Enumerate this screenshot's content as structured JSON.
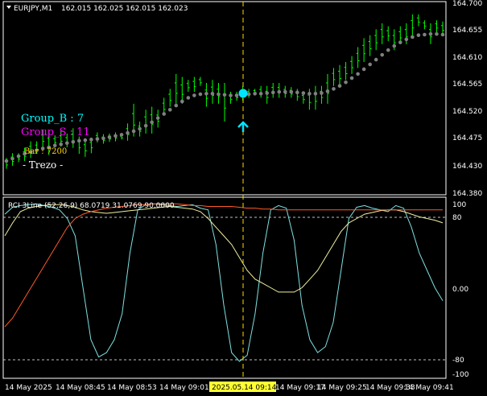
{
  "header": {
    "symbol": "EURJPY,M1",
    "ohlc": "162.015 162.025 162.015 162.023"
  },
  "overlay": {
    "group_b": "Group_B : 7",
    "group_s": "Group_S : 11",
    "bar": "Bar : 7200",
    "trezo": "- Trezo -"
  },
  "price_axis": [
    "164.700",
    "164.655",
    "164.610",
    "164.565",
    "164.520",
    "164.475",
    "164.430",
    "164.380"
  ],
  "indicator": {
    "label": "RCI 3Line (52,26,9) 68.0719 31.0769 90.0000",
    "axis": [
      "100",
      "80",
      "0.00",
      "-80",
      "-100"
    ]
  },
  "time_axis": [
    "14 May 2025",
    "14 May 08:45",
    "14 May 08:53",
    "14 May 09:01",
    "14 May 09:17",
    "14 May 09:25",
    "14 May 09:33",
    "14 May 09:41"
  ],
  "crosshair_time": "2025.05.14 09:14",
  "colors": {
    "bg": "#000000",
    "candle": "#00ff00",
    "ma_dots": "#808080",
    "crosshair": "#ffd700",
    "marker": "#00e5ff",
    "group_b": "#00ffff",
    "group_s": "#ff00ff",
    "bar": "#ffd700",
    "rci_short": "#7fe0e0",
    "rci_mid": "#f0f0a0",
    "rci_long": "#ff5a28"
  },
  "chart_data": {
    "type": "line",
    "price_range": [
      164.38,
      164.7
    ],
    "candles": [
      {
        "h": 164.439,
        "l": 164.421
      },
      {
        "h": 164.447,
        "l": 164.426
      },
      {
        "h": 164.447,
        "l": 164.432
      },
      {
        "h": 164.456,
        "l": 164.434
      },
      {
        "h": 164.467,
        "l": 164.439
      },
      {
        "h": 164.467,
        "l": 164.446
      },
      {
        "h": 164.487,
        "l": 164.456
      },
      {
        "h": 164.484,
        "l": 164.444
      },
      {
        "h": 164.477,
        "l": 164.458
      },
      {
        "h": 164.484,
        "l": 164.458
      },
      {
        "h": 164.48,
        "l": 164.457
      },
      {
        "h": 164.489,
        "l": 164.456
      },
      {
        "h": 164.475,
        "l": 164.446
      },
      {
        "h": 164.47,
        "l": 164.441
      },
      {
        "h": 164.473,
        "l": 164.447
      },
      {
        "h": 164.482,
        "l": 164.465
      },
      {
        "h": 164.479,
        "l": 164.463
      },
      {
        "h": 164.48,
        "l": 164.466
      },
      {
        "h": 164.482,
        "l": 164.467
      },
      {
        "h": 164.478,
        "l": 164.47
      },
      {
        "h": 164.497,
        "l": 164.468
      },
      {
        "h": 164.53,
        "l": 164.475
      },
      {
        "h": 164.5,
        "l": 164.475
      },
      {
        "h": 164.52,
        "l": 164.48
      },
      {
        "h": 164.525,
        "l": 164.48
      },
      {
        "h": 164.52,
        "l": 164.49
      },
      {
        "h": 164.54,
        "l": 164.51
      },
      {
        "h": 164.555,
        "l": 164.525
      },
      {
        "h": 164.58,
        "l": 164.53
      },
      {
        "h": 164.575,
        "l": 164.53
      },
      {
        "h": 164.57,
        "l": 164.55
      },
      {
        "h": 164.575,
        "l": 164.55
      },
      {
        "h": 164.575,
        "l": 164.56
      },
      {
        "h": 164.565,
        "l": 164.525
      },
      {
        "h": 164.57,
        "l": 164.53
      },
      {
        "h": 164.565,
        "l": 164.53
      },
      {
        "h": 164.565,
        "l": 164.5
      },
      {
        "h": 164.55,
        "l": 164.53
      },
      {
        "h": 164.55,
        "l": 164.535
      },
      {
        "h": 164.56,
        "l": 164.535
      },
      {
        "h": 164.555,
        "l": 164.54
      },
      {
        "h": 164.555,
        "l": 164.545
      },
      {
        "h": 164.56,
        "l": 164.54
      },
      {
        "h": 164.56,
        "l": 164.53
      },
      {
        "h": 164.565,
        "l": 164.54
      },
      {
        "h": 164.565,
        "l": 164.54
      },
      {
        "h": 164.56,
        "l": 164.54
      },
      {
        "h": 164.558,
        "l": 164.54
      },
      {
        "h": 164.555,
        "l": 164.535
      },
      {
        "h": 164.55,
        "l": 164.53
      },
      {
        "h": 164.555,
        "l": 164.52
      },
      {
        "h": 164.56,
        "l": 164.52
      },
      {
        "h": 164.56,
        "l": 164.53
      },
      {
        "h": 164.58,
        "l": 164.53
      },
      {
        "h": 164.59,
        "l": 164.56
      },
      {
        "h": 164.595,
        "l": 164.56
      },
      {
        "h": 164.6,
        "l": 164.57
      },
      {
        "h": 164.61,
        "l": 164.58
      },
      {
        "h": 164.625,
        "l": 164.59
      },
      {
        "h": 164.64,
        "l": 164.6
      },
      {
        "h": 164.645,
        "l": 164.61
      },
      {
        "h": 164.655,
        "l": 164.62
      },
      {
        "h": 164.665,
        "l": 164.63
      },
      {
        "h": 164.66,
        "l": 164.635
      },
      {
        "h": 164.655,
        "l": 164.62
      },
      {
        "h": 164.66,
        "l": 164.63
      },
      {
        "h": 164.665,
        "l": 164.63
      },
      {
        "h": 164.68,
        "l": 164.645
      },
      {
        "h": 164.68,
        "l": 164.66
      },
      {
        "h": 164.67,
        "l": 164.655
      },
      {
        "h": 164.665,
        "l": 164.63
      },
      {
        "h": 164.67,
        "l": 164.65
      },
      {
        "h": 164.668,
        "l": 164.645
      }
    ],
    "ma_dots": [
      164.434,
      164.438,
      164.442,
      164.446,
      164.449,
      164.452,
      164.455,
      164.457,
      164.46,
      164.462,
      164.464,
      164.466,
      164.468,
      164.469,
      164.47,
      164.471,
      164.472,
      164.474,
      164.476,
      164.478,
      164.481,
      164.484,
      164.488,
      164.493,
      164.499,
      164.506,
      164.513,
      164.52,
      164.527,
      164.534,
      164.54,
      164.544,
      164.546,
      164.547,
      164.547,
      164.546,
      164.545,
      164.544,
      164.544,
      164.545,
      164.546,
      164.547,
      164.547,
      164.548,
      164.549,
      164.55,
      164.55,
      164.55,
      164.549,
      164.548,
      164.547,
      164.547,
      164.548,
      164.551,
      164.555,
      164.56,
      164.566,
      164.573,
      164.58,
      164.588,
      164.596,
      164.604,
      164.612,
      164.62,
      164.627,
      164.633,
      164.638,
      164.642,
      164.645,
      164.646,
      164.647,
      164.647,
      164.646
    ],
    "rci": {
      "range": [
        -100,
        100
      ],
      "levels": [
        80,
        -80
      ],
      "series": [
        {
          "key": "short",
          "values": [
            85,
            93,
            95,
            96,
            97,
            95,
            93,
            90,
            80,
            60,
            0,
            -60,
            -80,
            -75,
            -60,
            -30,
            40,
            90,
            96,
            97,
            96,
            95,
            94,
            95,
            96,
            92,
            90,
            50,
            -20,
            -75,
            -85,
            -78,
            -30,
            40,
            90,
            95,
            92,
            55,
            -20,
            -60,
            -75,
            -68,
            -40,
            20,
            80,
            93,
            95,
            92,
            90,
            88,
            95,
            92,
            70,
            40,
            20,
            0,
            -15
          ]
        },
        {
          "key": "mid",
          "values": [
            60,
            75,
            88,
            92,
            94,
            95,
            96,
            96,
            95,
            93,
            90,
            88,
            87,
            86,
            87,
            88,
            89,
            90,
            91,
            92,
            93,
            94,
            93,
            92,
            91,
            88,
            80,
            70,
            60,
            50,
            35,
            20,
            10,
            5,
            0,
            -5,
            -5,
            -5,
            0,
            10,
            20,
            35,
            50,
            65,
            75,
            80,
            85,
            87,
            89,
            90,
            90,
            88,
            85,
            82,
            80,
            78,
            75
          ]
        },
        {
          "key": "long",
          "values": [
            -45,
            -35,
            -20,
            -5,
            10,
            25,
            40,
            55,
            70,
            80,
            85,
            88,
            90,
            92,
            93,
            94,
            95,
            96,
            96,
            97,
            97,
            97,
            97,
            96,
            95,
            95,
            94,
            94,
            94,
            94,
            93,
            92,
            92,
            91,
            91,
            90,
            90,
            90,
            90,
            90,
            90,
            90,
            90,
            90,
            90,
            90,
            90,
            90,
            90,
            90,
            90,
            90,
            90,
            90,
            90,
            90,
            90
          ]
        }
      ]
    }
  }
}
